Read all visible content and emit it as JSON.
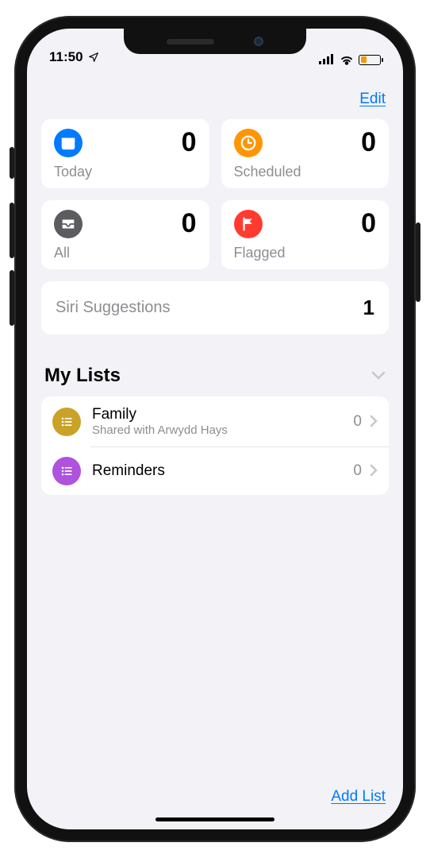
{
  "status": {
    "time": "11:50"
  },
  "header": {
    "edit": "Edit"
  },
  "tiles": {
    "today": {
      "label": "Today",
      "count": "0"
    },
    "scheduled": {
      "label": "Scheduled",
      "count": "0"
    },
    "all": {
      "label": "All",
      "count": "0"
    },
    "flagged": {
      "label": "Flagged",
      "count": "0"
    }
  },
  "siri": {
    "label": "Siri Suggestions",
    "count": "1"
  },
  "mylists": {
    "title": "My Lists",
    "items": [
      {
        "name": "Family",
        "subtitle": "Shared with Arwydd Hays",
        "count": "0"
      },
      {
        "name": "Reminders",
        "subtitle": "",
        "count": "0"
      }
    ]
  },
  "footer": {
    "add_list": "Add List"
  }
}
